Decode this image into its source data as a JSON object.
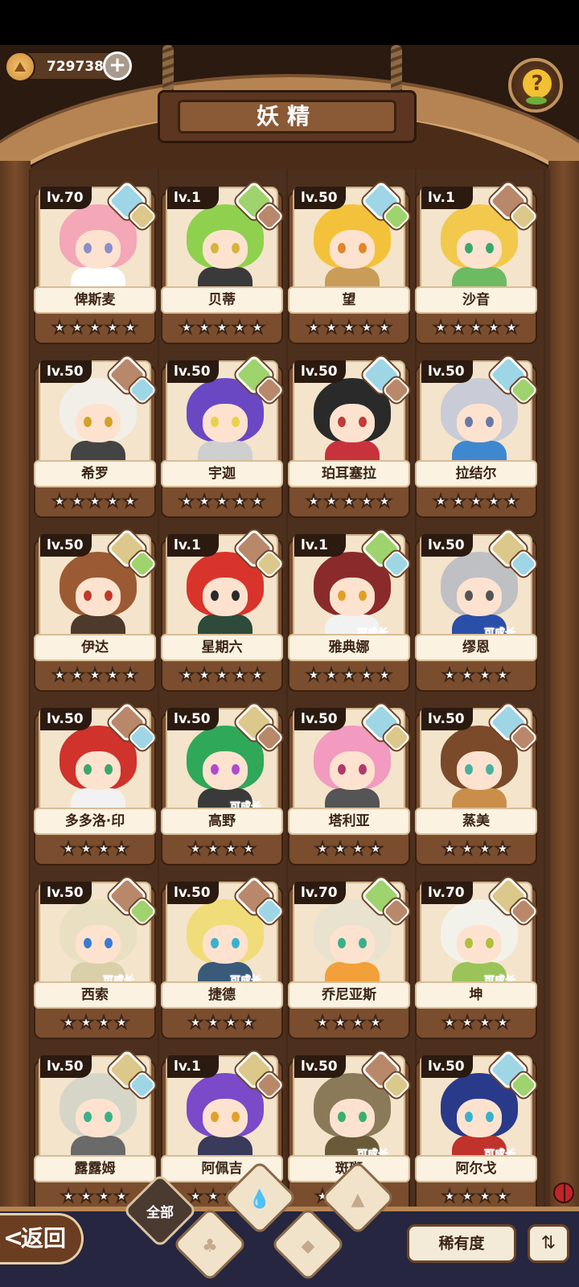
{
  "header": {
    "title": "妖精",
    "currency_value": "729738"
  },
  "icons": {
    "currency": "crown-coin-icon",
    "add": "plus-icon",
    "help": "question-mark-icon"
  },
  "element_colors": {
    "water": "#9fd6e6",
    "grass": "#9fd36d",
    "earth": "#dcc88a",
    "mountain": "#b9886a"
  },
  "cards": [
    {
      "level": "lv.70",
      "name": "俾斯麦",
      "stars": 5,
      "element": "water",
      "sub": "earth",
      "grow": "",
      "hair": "#f4a7b7",
      "eye": "#8a8fc9",
      "outfit": "#ffffff"
    },
    {
      "level": "lv.1",
      "name": "贝蒂",
      "stars": 5,
      "element": "grass",
      "sub": "mountain",
      "grow": "",
      "hair": "#8fd14f",
      "eye": "#d4b43a",
      "outfit": "#3a3a3a"
    },
    {
      "level": "lv.50",
      "name": "望",
      "stars": 5,
      "element": "water",
      "sub": "grass",
      "grow": "",
      "hair": "#f4c23a",
      "eye": "#e0862b",
      "outfit": "#c99d58"
    },
    {
      "level": "lv.1",
      "name": "沙音",
      "stars": 5,
      "element": "mountain",
      "sub": "earth",
      "grow": "",
      "hair": "#f2c94c",
      "eye": "#3aa86b",
      "outfit": "#6cbb63"
    },
    {
      "level": "lv.50",
      "name": "希罗",
      "stars": 5,
      "element": "mountain",
      "sub": "water",
      "grow": "",
      "hair": "#f2efe9",
      "eye": "#d4a12a",
      "outfit": "#444444"
    },
    {
      "level": "lv.50",
      "name": "宇迦",
      "stars": 5,
      "element": "grass",
      "sub": "mountain",
      "grow": "",
      "hair": "#6a48c4",
      "eye": "#e8d24a",
      "outfit": "#cfcfcf"
    },
    {
      "level": "lv.50",
      "name": "珀耳塞拉",
      "stars": 5,
      "element": "water",
      "sub": "mountain",
      "grow": "",
      "hair": "#2a2a2a",
      "eye": "#c03a3a",
      "outfit": "#c8333b"
    },
    {
      "level": "lv.50",
      "name": "拉结尔",
      "stars": 5,
      "element": "water",
      "sub": "grass",
      "grow": "",
      "hair": "#c9ccd6",
      "eye": "#6a7aa8",
      "outfit": "#3e88d0"
    },
    {
      "level": "lv.50",
      "name": "伊达",
      "stars": 5,
      "element": "earth",
      "sub": "grass",
      "grow": "",
      "hair": "#9c5a34",
      "eye": "#c0392b",
      "outfit": "#4d3a2a"
    },
    {
      "level": "lv.1",
      "name": "星期六",
      "stars": 5,
      "element": "mountain",
      "sub": "earth",
      "grow": "",
      "hair": "#d9342b",
      "eye": "#2a2a2a",
      "outfit": "#2d4a3a"
    },
    {
      "level": "lv.1",
      "name": "雅典娜",
      "stars": 5,
      "element": "grass",
      "sub": "water",
      "grow": "可成长",
      "hair": "#8a2a2a",
      "eye": "#e0a02a",
      "outfit": "#f2f2f2"
    },
    {
      "level": "lv.50",
      "name": "缪恩",
      "stars": 4,
      "element": "earth",
      "sub": "water",
      "grow": "可成长",
      "hair": "#bfc0c4",
      "eye": "#555555",
      "outfit": "#2a4fa8"
    },
    {
      "level": "lv.50",
      "name": "多多洛·印",
      "stars": 4,
      "element": "mountain",
      "sub": "water",
      "grow": "",
      "hair": "#d0322c",
      "eye": "#3aa86b",
      "outfit": "#f2f2f2"
    },
    {
      "level": "lv.50",
      "name": "高野",
      "stars": 4,
      "element": "earth",
      "sub": "mountain",
      "grow": "可成长",
      "hair": "#2fa85a",
      "eye": "#b04ad0",
      "outfit": "#3a3a3a"
    },
    {
      "level": "lv.50",
      "name": "塔利亚",
      "stars": 4,
      "element": "water",
      "sub": "earth",
      "grow": "",
      "hair": "#f29ac0",
      "eye": "#b03a6a",
      "outfit": "#555555"
    },
    {
      "level": "lv.50",
      "name": "蒸美",
      "stars": 4,
      "element": "water",
      "sub": "mountain",
      "grow": "",
      "hair": "#7a4a2a",
      "eye": "#4ab0a0",
      "outfit": "#c98e4a"
    },
    {
      "level": "lv.50",
      "name": "西索",
      "stars": 4,
      "element": "mountain",
      "sub": "grass",
      "grow": "可成长",
      "hair": "#e9e0c2",
      "eye": "#3a7ad0",
      "outfit": "#d9cfa9"
    },
    {
      "level": "lv.50",
      "name": "捷德",
      "stars": 4,
      "element": "mountain",
      "sub": "water",
      "grow": "可成长",
      "hair": "#f1dc7a",
      "eye": "#3ab0d0",
      "outfit": "#3a5a7a"
    },
    {
      "level": "lv.70",
      "name": "乔尼亚斯",
      "stars": 4,
      "element": "grass",
      "sub": "mountain",
      "grow": "",
      "hair": "#e8e2cf",
      "eye": "#3ab08a",
      "outfit": "#f2a03a"
    },
    {
      "level": "lv.70",
      "name": "坤",
      "stars": 4,
      "element": "earth",
      "sub": "mountain",
      "grow": "可成长",
      "hair": "#f2f2ea",
      "eye": "#b0c03a",
      "outfit": "#9ac45a"
    },
    {
      "level": "lv.50",
      "name": "露露姆",
      "stars": 4,
      "element": "earth",
      "sub": "water",
      "grow": "",
      "hair": "#d6d6c8",
      "eye": "#3ab08a",
      "outfit": "#6a6a6a"
    },
    {
      "level": "lv.1",
      "name": "阿佩吉",
      "stars": 4,
      "element": "earth",
      "sub": "mountain",
      "grow": "",
      "hair": "#7a4ac8",
      "eye": "#e0a02a",
      "outfit": "#3a3a5a"
    },
    {
      "level": "lv.50",
      "name": "斑斑",
      "stars": 4,
      "element": "mountain",
      "sub": "earth",
      "grow": "可成长",
      "hair": "#8a7a5a",
      "eye": "#3ab06a",
      "outfit": "#6a5a3a"
    },
    {
      "level": "lv.50",
      "name": "阿尔戈",
      "stars": 4,
      "element": "water",
      "sub": "grass",
      "grow": "可成长",
      "hair": "#2a3a8a",
      "eye": "#3ab0d0",
      "outfit": "#c0322c"
    }
  ],
  "footer": {
    "back_label": "返回",
    "filter_all_label": "全部",
    "rarity_label": "稀有度",
    "filters": [
      "water-filter-icon",
      "grass-filter-icon",
      "mountain-filter-icon",
      "earth-filter-icon"
    ]
  }
}
